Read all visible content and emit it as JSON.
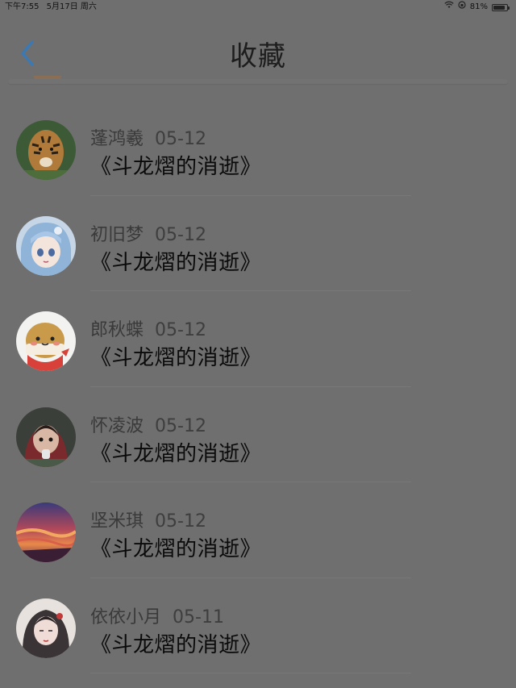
{
  "status_bar": {
    "time": "下午7:55",
    "date": "5月17日 周六",
    "battery": "81%",
    "battery_level": 0.81
  },
  "header": {
    "title": "收藏",
    "back_icon": "chevron-left-icon",
    "accent_color": "#3b82c4"
  },
  "favorites": [
    {
      "user": "蓬鸿羲",
      "date": "05-12",
      "book": "《斗龙熠的消逝》",
      "avatar": "tiger"
    },
    {
      "user": "初旧梦",
      "date": "05-12",
      "book": "《斗龙熠的消逝》",
      "avatar": "anime-girl-blue"
    },
    {
      "user": "郎秋蝶",
      "date": "05-12",
      "book": "《斗龙熠的消逝》",
      "avatar": "cartoon-potato"
    },
    {
      "user": "怀凌波",
      "date": "05-12",
      "book": "《斗龙熠的消逝》",
      "avatar": "child-photo"
    },
    {
      "user": "坚米琪",
      "date": "05-12",
      "book": "《斗龙熠的消逝》",
      "avatar": "sunset-sky"
    },
    {
      "user": "依依小月",
      "date": "05-11",
      "book": "《斗龙熠的消逝》",
      "avatar": "ink-girl"
    }
  ]
}
